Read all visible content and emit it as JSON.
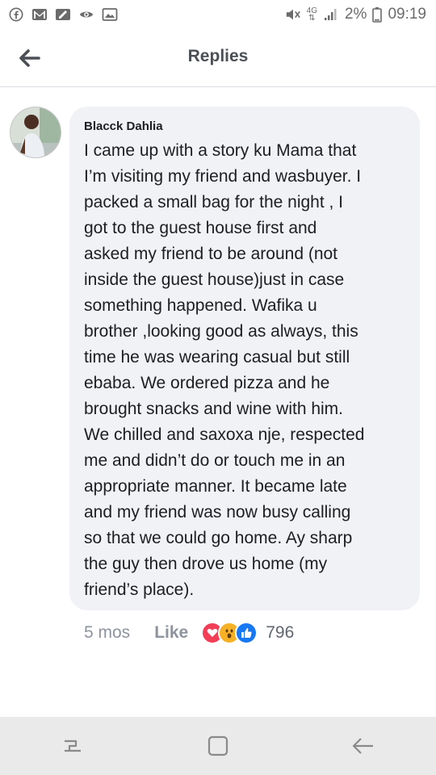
{
  "status_bar": {
    "left_icons": [
      "facebook-icon",
      "gmail-icon",
      "notification-icon",
      "camera-icon",
      "gallery-icon"
    ],
    "right_icons": [
      "mute-icon",
      "network-icon",
      "signal-icon",
      "battery-icon"
    ],
    "network": "4G",
    "battery": "2%",
    "time": "09:19"
  },
  "header": {
    "title": "Replies",
    "back_icon": "back-arrow-icon"
  },
  "comment": {
    "author": "Blacck Dahlia",
    "text": "I came up with a story ku Mama that\nI’m visiting my friend and wasbuyer. I\npacked a small bag for the night , I\ngot to the guest house first and\nasked my friend to be around (not\ninside the guest house)just in case\nsomething happened. Wafika u\nbrother ,looking good as always, this\ntime he was wearing casual but still\nebaba. We ordered pizza and he\nbrought snacks and wine with him.\nWe chilled and saxoxa nje, respected\nme and didn’t do or touch me in an\nappropriate manner. It became late\nand my friend was now busy calling\nso that we could go home. Ay sharp\nthe guy then drove us home (my\nfriend’s place).",
    "time": "5 mos",
    "like_label": "Like",
    "reactions": [
      "love-icon",
      "wow-icon",
      "like-icon"
    ],
    "reaction_count": "796"
  },
  "nav_bar": {
    "buttons": [
      "recent-apps-icon",
      "home-icon",
      "back-icon"
    ]
  },
  "colors": {
    "bubble": "#f0f2f5",
    "love": "#f33e58",
    "wow": "#f7b125",
    "like": "#1877f2"
  }
}
